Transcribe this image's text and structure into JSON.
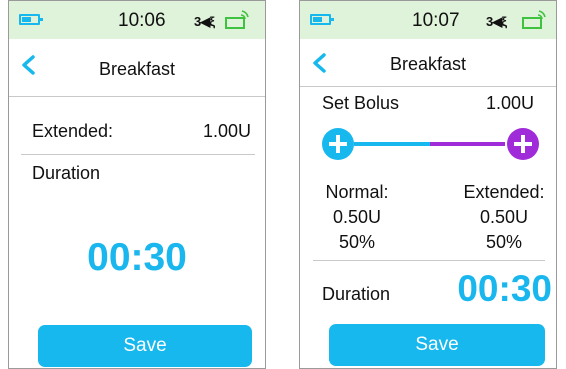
{
  "screens": [
    {
      "status": {
        "time": "10:06",
        "vibrate_icon": "vibrate-icon",
        "signal_icon": "signal-icon",
        "battery_icon": "battery-icon"
      },
      "title": "Breakfast",
      "extended_label": "Extended:",
      "extended_value": "1.00U",
      "duration_label": "Duration",
      "duration_value": "00:30",
      "save_label": "Save"
    },
    {
      "status": {
        "time": "10:07",
        "vibrate_icon": "vibrate-icon",
        "signal_icon": "signal-icon",
        "battery_icon": "battery-icon"
      },
      "title": "Breakfast",
      "set_bolus_label": "Set Bolus",
      "set_bolus_value": "1.00U",
      "slider": {
        "split_fraction": 0.5
      },
      "normal": {
        "label": "Normal:",
        "amount": "0.50U",
        "percent": "50%"
      },
      "extended": {
        "label": "Extended:",
        "amount": "0.50U",
        "percent": "50%"
      },
      "duration_label": "Duration",
      "duration_value": "00:30",
      "save_label": "Save"
    }
  ],
  "colors": {
    "accent": "#17b8ee",
    "extended": "#a02bd8",
    "status_bar": "#dff2da",
    "signal": "#3fc23f"
  }
}
